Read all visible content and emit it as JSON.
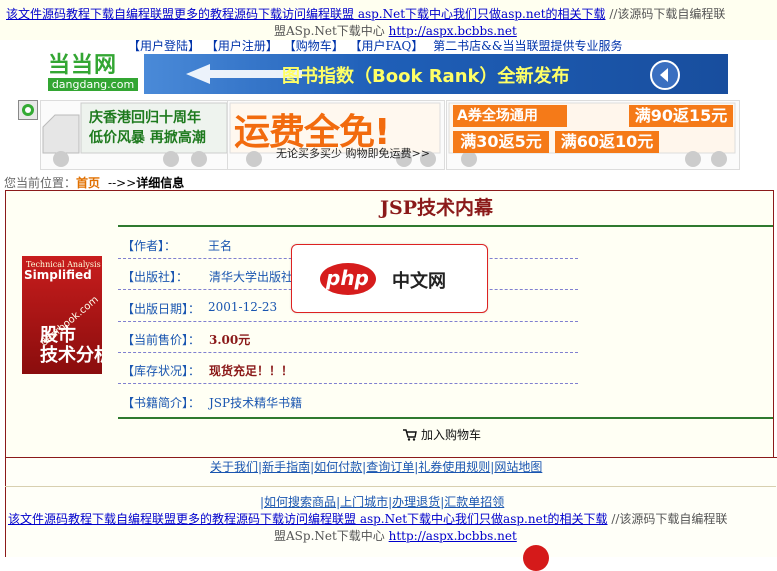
{
  "top_ticker": {
    "link_text": "该文件源码教程下载自编程联盟更多的教程源码下载访问编程联盟  asp.Net下载中心我们只做asp.net的相关下载",
    "tail": " //该源码下载自编程联",
    "line2_prefix": "盟ASp.Net下载中心  ",
    "line2_url": "http://aspx.bcbbs.net"
  },
  "nav": {
    "items": [
      "【用户登陆】",
      "【用户注册】",
      "【购物车】",
      "【用户FAQ】"
    ],
    "tagline": "第二书店&&当当联盟提供专业服务"
  },
  "logo": {
    "brand": "当当网",
    "domain": "dangdang.com"
  },
  "banner": {
    "text": "图书指数（Book Rank）全新发布"
  },
  "promos": {
    "p1": {
      "line1": "庆香港回归十周年",
      "line2": "低价风暴  再掀高潮"
    },
    "p2": {
      "headline": "运费全免!",
      "sub": "无论买多买少 购物即免运费>>"
    },
    "p3": {
      "b1": "A券全场通用",
      "b2": "满90返15元",
      "b3": "满30返5元",
      "b4": "满60返10元"
    }
  },
  "breadcrumb": {
    "prefix": "您当前位置：",
    "home": "首页",
    "sep": "-->>",
    "current": "详细信息"
  },
  "book": {
    "title": "JSP技术内幕",
    "cover": {
      "line1": "Technical Analysis",
      "line2": "Simplified",
      "line3": "股市",
      "line4": "技术分析手册",
      "watermark": "dearbook.com"
    },
    "fields": [
      {
        "label": "【作者】：",
        "value": "王名"
      },
      {
        "label": "【出版社】：",
        "value": "清华大学出版社"
      },
      {
        "label": "【出版日期】：",
        "value": "2001-12-23"
      },
      {
        "label": "【当前售价】：",
        "value": "3.00元"
      },
      {
        "label": "【库存状况】：",
        "value": "现货充足！！！"
      },
      {
        "label": "【书籍简介】：",
        "value": "JSP技术精华书籍"
      }
    ],
    "cart_label": "加入购物车"
  },
  "overlay": {
    "php": "php",
    "cn": "中文网"
  },
  "footer": {
    "links1": [
      "关于我们",
      "新手指南",
      "如何付款",
      "查询订单",
      "礼券使用规则",
      "网站地图"
    ],
    "links2": [
      "如何搜索商品",
      "上门城市",
      "办理退货",
      "汇款单招领"
    ],
    "ticker": {
      "link_text": "该文件源码教程下载自编程联盟更多的教程源码下载访问编程联盟  asp.Net下载中心我们只做asp.net的相关下载",
      "tail": " //该源码下载自编程联",
      "line2_prefix": "盟ASp.Net下载中心  ",
      "line2_url": "http://aspx.bcbbs.net"
    }
  },
  "colors": {
    "accent": "#8b1a1a",
    "link": "#1a56b0",
    "green": "#2f7a2f",
    "orange": "#f57a18"
  }
}
